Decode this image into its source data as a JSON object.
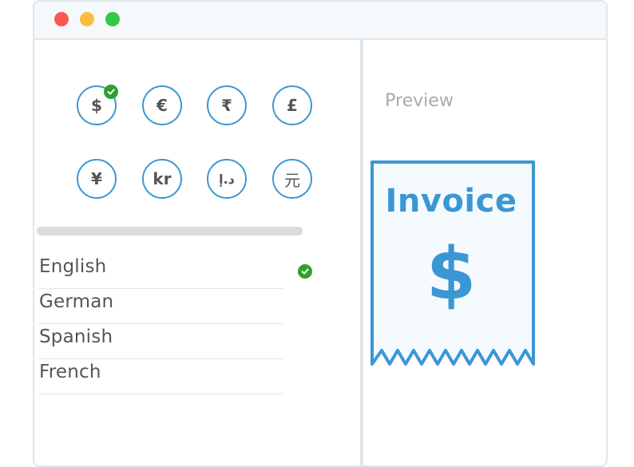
{
  "window": {
    "controls": [
      {
        "name": "close",
        "color": "#fc5753"
      },
      {
        "name": "minimize",
        "color": "#fdbc40"
      },
      {
        "name": "maximize",
        "color": "#33c748"
      }
    ]
  },
  "currencies": [
    {
      "symbol": "$",
      "selected": true
    },
    {
      "symbol": "€",
      "selected": false
    },
    {
      "symbol": "₹",
      "selected": false
    },
    {
      "symbol": "£",
      "selected": false
    },
    {
      "symbol": "¥",
      "selected": false
    },
    {
      "symbol": "kr",
      "selected": false
    },
    {
      "symbol": "د.إ",
      "selected": false
    },
    {
      "symbol": "元",
      "selected": false
    }
  ],
  "languages": [
    {
      "label": "English",
      "selected": true
    },
    {
      "label": "German",
      "selected": false
    },
    {
      "label": "Spanish",
      "selected": false
    },
    {
      "label": "French",
      "selected": false
    }
  ],
  "preview": {
    "label": "Preview",
    "invoice_title": "Invoice",
    "currency_symbol": "$"
  },
  "colors": {
    "accent": "#3b97d3",
    "check": "#2ea02e",
    "text": "#555555"
  }
}
